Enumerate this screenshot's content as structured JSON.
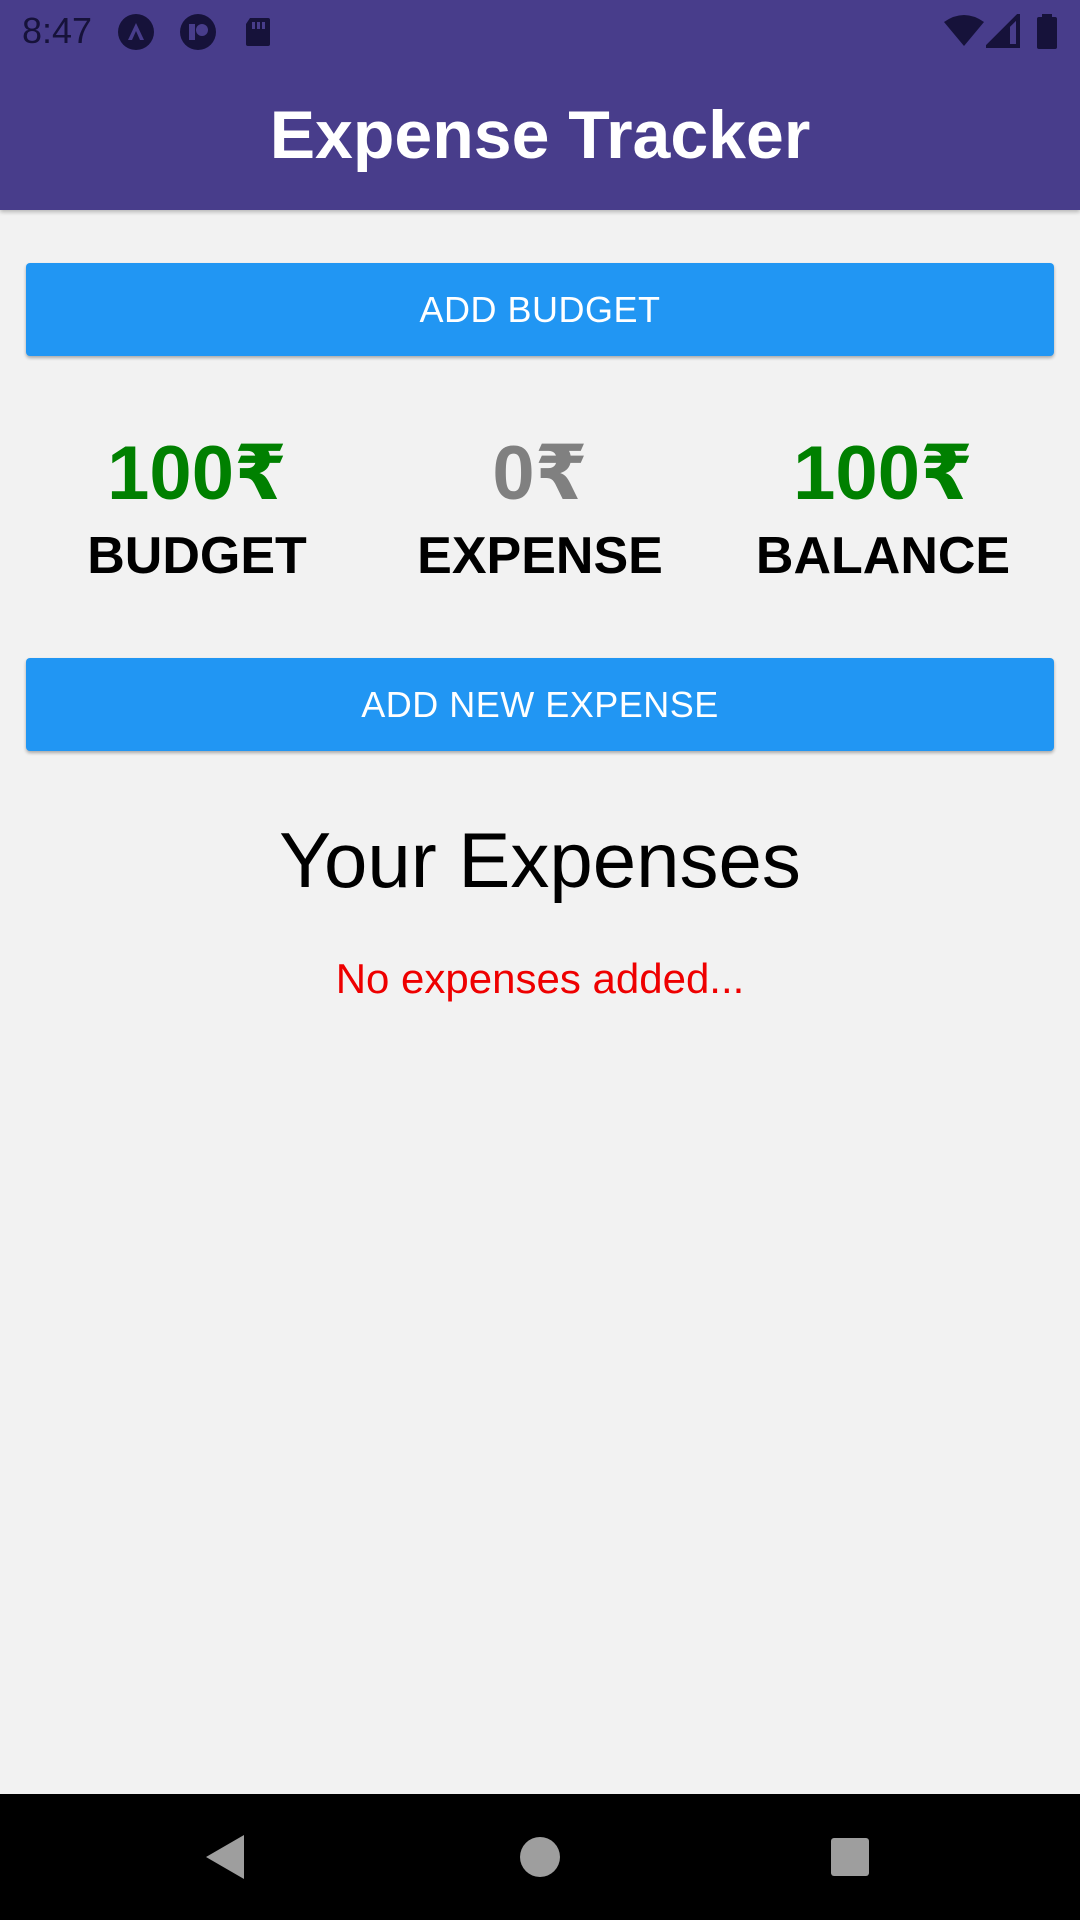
{
  "status_bar": {
    "time": "8:47",
    "left_icons": [
      "notification-a-icon",
      "notification-b-icon",
      "sd-card-icon"
    ],
    "right_icons": [
      "wifi-icon",
      "cell-signal-icon",
      "battery-icon"
    ]
  },
  "app_bar": {
    "title": "Expense Tracker",
    "color": "#483d8b"
  },
  "buttons": {
    "add_budget": "ADD BUDGET",
    "add_expense": "ADD NEW EXPENSE",
    "color": "#2196f3"
  },
  "summary": {
    "budget": {
      "value": "100₹",
      "label": "BUDGET",
      "color": "#008000"
    },
    "expense": {
      "value": "0₹",
      "label": "EXPENSE",
      "color": "#808080"
    },
    "balance": {
      "value": "100₹",
      "label": "BALANCE",
      "color": "#008000"
    }
  },
  "expenses": {
    "title": "Your Expenses",
    "empty_message": "No expenses added...",
    "empty_color": "#ee0000"
  },
  "nav_bar": {
    "icons": [
      "back-icon",
      "home-icon",
      "recents-icon"
    ]
  }
}
